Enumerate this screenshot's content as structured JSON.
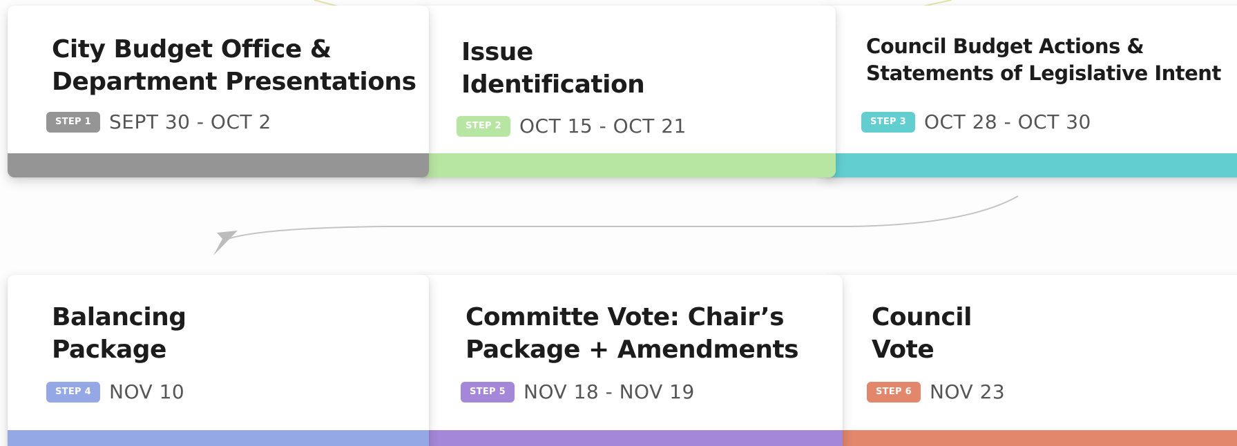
{
  "steps": [
    {
      "title": "City Budget Office &\nDepartment Presentations",
      "badge": "STEP 1",
      "dates": "SEPT 30 - OCT 2",
      "color": "#959595"
    },
    {
      "title": "Issue\nIdentification",
      "badge": "STEP 2",
      "dates": "OCT 15 - OCT 21",
      "color": "#b7e6a3"
    },
    {
      "title": "Council Budget Actions &\nStatements of Legislative Intent",
      "badge": "STEP 3",
      "dates": "OCT 28 - OCT 30",
      "color": "#62ced0"
    },
    {
      "title": "Balancing\nPackage",
      "badge": "STEP 4",
      "dates": "NOV 10",
      "color": "#93a8e4"
    },
    {
      "title": "Committe Vote: Chair’s\nPackage + Amendments",
      "badge": "STEP 5",
      "dates": "NOV 18 - NOV 19",
      "color": "#a487d8"
    },
    {
      "title": "Council\nVote",
      "badge": "STEP 6",
      "dates": "NOV 23",
      "color": "#e2876c"
    }
  ],
  "colors": {
    "connector": "#c4c4c4",
    "connector_top": "#e6e3a6",
    "title_text": "#1c1c1c",
    "date_text": "#555555"
  }
}
